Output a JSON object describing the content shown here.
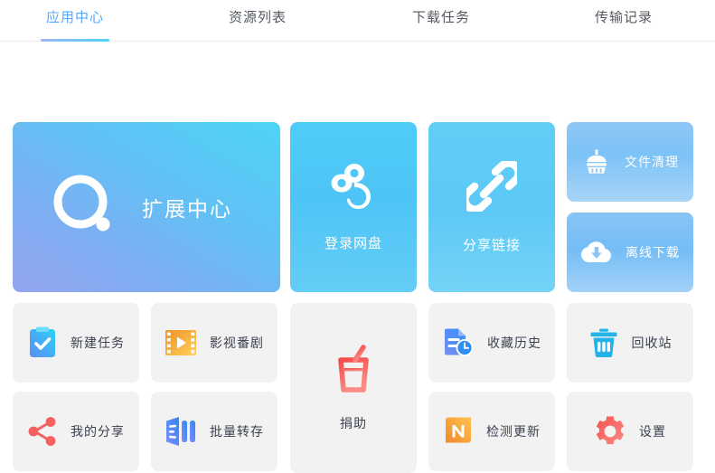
{
  "tabs": [
    {
      "label": "应用中心",
      "active": true
    },
    {
      "label": "资源列表",
      "active": false
    },
    {
      "label": "下载任务",
      "active": false
    },
    {
      "label": "传输记录",
      "active": false
    }
  ],
  "hero": {
    "label": "扩展中心",
    "icon": "circle-dot-logo-icon"
  },
  "feature_cards": [
    {
      "label": "登录网盘",
      "icon": "baidu-cloud-icon"
    },
    {
      "label": "分享链接",
      "icon": "link-chain-icon"
    }
  ],
  "side_cards": [
    {
      "label": "文件清理",
      "icon": "broom-icon"
    },
    {
      "label": "离线下载",
      "icon": "cloud-download-icon"
    }
  ],
  "tiles": [
    {
      "label": "新建任务",
      "icon": "clipboard-check-icon"
    },
    {
      "label": "影视番剧",
      "icon": "film-play-icon"
    },
    {
      "label": "捐助",
      "icon": "coffee-cup-icon"
    },
    {
      "label": "收藏历史",
      "icon": "document-clock-icon"
    },
    {
      "label": "回收站",
      "icon": "trash-bin-icon"
    },
    {
      "label": "我的分享",
      "icon": "share-nodes-icon"
    },
    {
      "label": "批量转存",
      "icon": "batch-save-icon"
    },
    {
      "label": "检测更新",
      "icon": "letter-n-badge-icon"
    },
    {
      "label": "设置",
      "icon": "gear-icon"
    }
  ],
  "colors": {
    "accent": "#56a8ff",
    "tile_bg": "#f2f2f2",
    "page_bg": "#ffffff",
    "hero_gradient_start": "#4fd3f8",
    "hero_gradient_end": "#93a4f0",
    "orange": "#f5a742",
    "red": "#f4615f",
    "cyan": "#29b6e8",
    "blue": "#3d8bf5"
  }
}
